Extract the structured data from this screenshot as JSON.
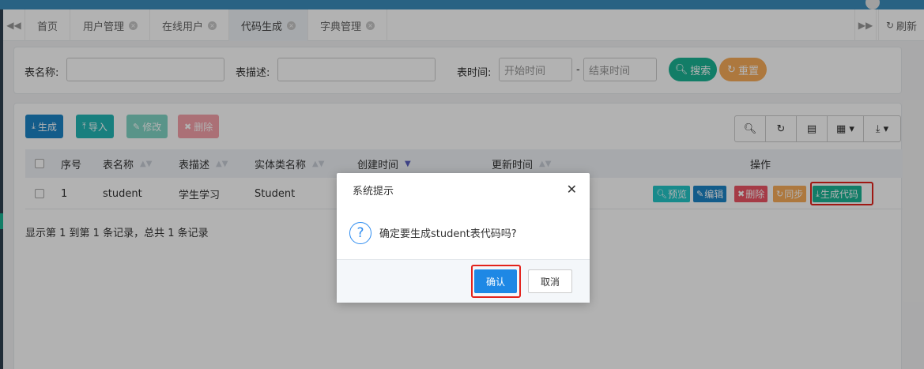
{
  "tabs": {
    "items": [
      {
        "label": "首页"
      },
      {
        "label": "用户管理"
      },
      {
        "label": "在线用户"
      },
      {
        "label": "代码生成"
      },
      {
        "label": "字典管理"
      }
    ],
    "refresh_label": "刷新"
  },
  "search": {
    "table_name_label": "表名称:",
    "table_desc_label": "表描述:",
    "table_time_label": "表时间:",
    "start_placeholder": "开始时间",
    "end_placeholder": "结束时间",
    "range_separator": "-",
    "search_label": "搜索",
    "reset_label": "重置"
  },
  "toolbar": {
    "generate_label": "生成",
    "import_label": "导入",
    "edit_label": "修改",
    "delete_label": "删除"
  },
  "table": {
    "headers": {
      "index": "序号",
      "table_name": "表名称",
      "table_desc": "表描述",
      "class_name": "实体类名称",
      "create_time": "创建时间",
      "update_time": "更新时间",
      "actions": "操作"
    },
    "rows": [
      {
        "index": "1",
        "table_name": "student",
        "table_desc": "学生学习",
        "class_name": "Student"
      }
    ],
    "row_actions": {
      "preview": "预览",
      "edit": "编辑",
      "delete": "删除",
      "sync": "同步",
      "generate": "生成代码"
    },
    "pagination_info": "显示第 1 到第 1 条记录，总共 1 条记录"
  },
  "dialog": {
    "title": "系统提示",
    "message": "确定要生成student表代码吗?",
    "confirm_label": "确认",
    "cancel_label": "取消"
  },
  "colors": {
    "primary_blue": "#3c8dbc",
    "green": "#1ab394",
    "cyan": "#23c6c8",
    "orange": "#f8ac59",
    "red": "#ed5565",
    "confirm_blue": "#1e88e5",
    "highlight_red": "#e3231c"
  }
}
